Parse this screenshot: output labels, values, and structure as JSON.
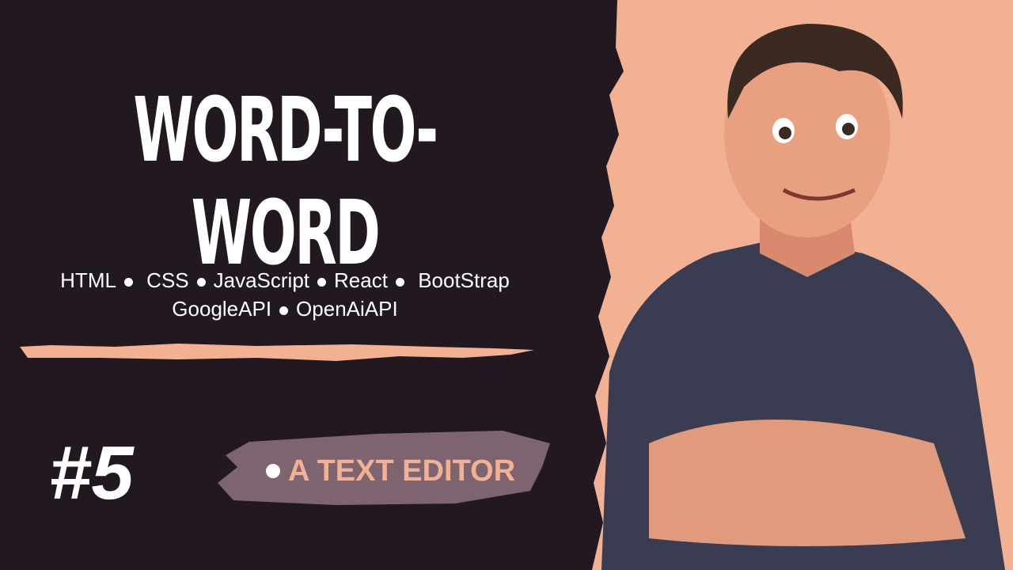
{
  "title": "WORD-TO-WORD",
  "tech_line1": [
    "HTML",
    "CSS",
    "JavaScript",
    "React",
    "BootStrap"
  ],
  "tech_line2": [
    "GoogleAPI",
    "OpenAiAPI"
  ],
  "episode": "#5",
  "subtitle": "A TEXT EDITOR",
  "colors": {
    "background": "#211820",
    "accent": "#f2b193",
    "brush": "#7d6470"
  }
}
